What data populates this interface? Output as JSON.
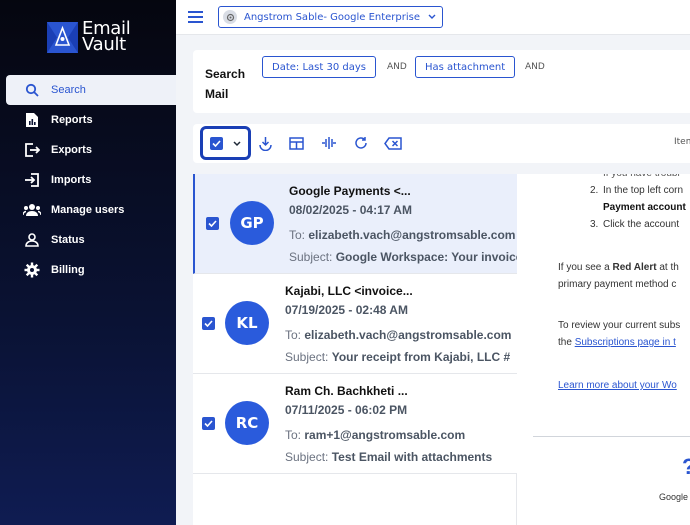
{
  "brand": {
    "line1": "Email",
    "line2": "Vault"
  },
  "sidebar": {
    "items": [
      {
        "label": "Search",
        "icon": "search-icon",
        "active": true
      },
      {
        "label": "Reports",
        "icon": "report-icon"
      },
      {
        "label": "Exports",
        "icon": "export-icon"
      },
      {
        "label": "Imports",
        "icon": "import-icon"
      },
      {
        "label": "Manage users",
        "icon": "users-icon"
      },
      {
        "label": "Status",
        "icon": "user-icon"
      },
      {
        "label": "Billing",
        "icon": "gear-icon"
      }
    ]
  },
  "topbar": {
    "account": "Angstrom Sable- Google Enterprise"
  },
  "search": {
    "title_line1": "Search",
    "title_line2": "Mail",
    "filters": [
      {
        "label": "Date: Last 30 days"
      },
      {
        "label": "Has attachment"
      }
    ],
    "and_label": "AND"
  },
  "toolbar": {
    "items_label": "Item"
  },
  "emails": [
    {
      "initials": "GP",
      "from": "Google Payments <...",
      "date": "08/02/2025 - 04:17 AM",
      "to_label": "To:",
      "to": "elizabeth.vach@angstromsable.com",
      "subject_label": "Subject:",
      "subject": "Google Workspace: Your invoice",
      "selected": true
    },
    {
      "initials": "KL",
      "from": "Kajabi, LLC <invoice...",
      "date": "07/19/2025 - 02:48 AM",
      "to_label": "To:",
      "to": "elizabeth.vach@angstromsable.com",
      "subject_label": "Subject:",
      "subject": "Your receipt from Kajabi, LLC #",
      "selected": false
    },
    {
      "initials": "RC",
      "from": "Ram Ch. Bachkheti ...",
      "date": "07/11/2025 - 06:02 PM",
      "to_label": "To:",
      "to": "ram+1@angstromsable.com",
      "subject_label": "Subject:",
      "subject": "Test Email with attachments",
      "selected": false
    }
  ],
  "preview": {
    "line1": "If you have troubl",
    "step2_num": "2.",
    "step2": "In the top left corn",
    "step2b": "Payment account",
    "step3_num": "3.",
    "step3": "Click the account",
    "alert_pre": "If you see a ",
    "alert_bold": "Red Alert",
    "alert_post": " at th",
    "alert_line2": "primary payment method c",
    "review_line1": "To review your current subs",
    "review_pre": "the ",
    "review_link": "Subscriptions page in t",
    "learn_link": "Learn more about your Wo",
    "footer_mark": "?",
    "footer_text": "Google"
  },
  "colors": {
    "accent": "#2a55d0",
    "avatar": "#2a5bdc",
    "sidebar": "#0a1233"
  }
}
